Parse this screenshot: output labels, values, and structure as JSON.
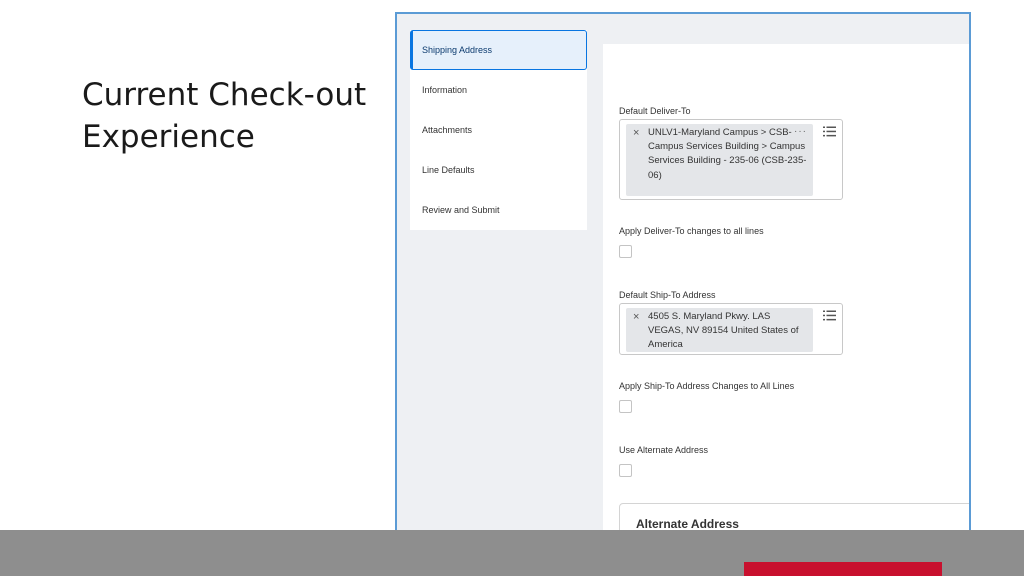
{
  "slide": {
    "title_line1": "Current Check-out",
    "title_line2": "Experience"
  },
  "nav": {
    "items": [
      {
        "label": "Shipping Address"
      },
      {
        "label": "Information"
      },
      {
        "label": "Attachments"
      },
      {
        "label": "Line Defaults"
      },
      {
        "label": "Review and Submit"
      }
    ]
  },
  "form": {
    "deliver_to": {
      "label": "Default Deliver-To",
      "value": "UNLV1-Maryland Campus > CSB-Campus Services Building > Campus Services Building - 235-06 (CSB-235-06)",
      "more": "···",
      "remove": "×"
    },
    "apply_deliver_to": {
      "label": "Apply Deliver-To changes to all lines"
    },
    "ship_to": {
      "label": "Default Ship-To Address",
      "value": "4505 S. Maryland Pkwy. LAS VEGAS, NV 89154 United States of America",
      "remove": "×"
    },
    "apply_ship_to": {
      "label": "Apply Ship-To Address Changes to All Lines"
    },
    "use_alternate": {
      "label": "Use Alternate Address"
    },
    "alternate_card": {
      "title": "Alternate Address"
    }
  },
  "colors": {
    "accent": "#0875e1",
    "frame": "#5b9bd5",
    "footer_gray": "#8e8e8e",
    "footer_red": "#c8102e"
  }
}
